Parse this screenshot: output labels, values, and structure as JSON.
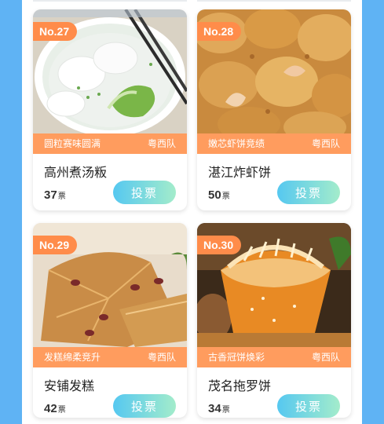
{
  "cards": [
    {
      "no": "No.27",
      "slogan": "圆粒赛味圆满",
      "team": "粤西队",
      "name": "高州煮汤粄",
      "votes": "37",
      "unit": "票",
      "button": "投票"
    },
    {
      "no": "No.28",
      "slogan": "嫩芯虾饼竞绩",
      "team": "粤西队",
      "name": "湛江炸虾饼",
      "votes": "50",
      "unit": "票",
      "button": "投票"
    },
    {
      "no": "No.29",
      "slogan": "发糕绵柔竞升",
      "team": "粤西队",
      "name": "安铺发糕",
      "votes": "42",
      "unit": "票",
      "button": "投票"
    },
    {
      "no": "No.30",
      "slogan": "古香冠饼焕彩",
      "team": "粤西队",
      "name": "茂名拖罗饼",
      "votes": "34",
      "unit": "票",
      "button": "投票"
    }
  ]
}
